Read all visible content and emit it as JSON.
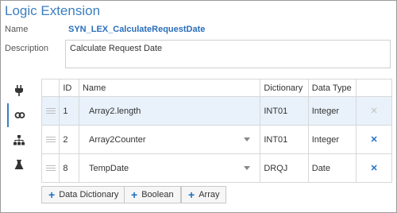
{
  "header": {
    "title": "Logic Extension"
  },
  "form": {
    "name_label": "Name",
    "name_value": "SYN_LEX_CalculateRequestDate",
    "description_label": "Description",
    "description_value": "Calculate Request Date"
  },
  "sidebar": {
    "icons": [
      "plug-icon",
      "link-icon",
      "hierarchy-icon",
      "flask-icon"
    ],
    "active_index": 1
  },
  "table": {
    "headers": {
      "id": "ID",
      "name": "Name",
      "dictionary": "Dictionary",
      "data_type": "Data Type"
    },
    "rows": [
      {
        "id": "1",
        "name": "Array2.length",
        "dictionary": "INT01",
        "data_type": "Integer",
        "has_dropdown": false,
        "delete_enabled": false
      },
      {
        "id": "2",
        "name": "Array2Counter",
        "dictionary": "INT01",
        "data_type": "Integer",
        "has_dropdown": true,
        "delete_enabled": true
      },
      {
        "id": "8",
        "name": "TempDate",
        "dictionary": "DRQJ",
        "data_type": "Date",
        "has_dropdown": true,
        "delete_enabled": true
      }
    ]
  },
  "buttons": {
    "plus_glyph": "+",
    "data_dictionary": "Data Dictionary",
    "boolean": "Boolean",
    "array": "Array"
  },
  "colors": {
    "accent": "#3a7fc1",
    "delete_active": "#1f6fc6",
    "delete_disabled": "#cccccc",
    "selected_row": "#e9f2fb"
  }
}
